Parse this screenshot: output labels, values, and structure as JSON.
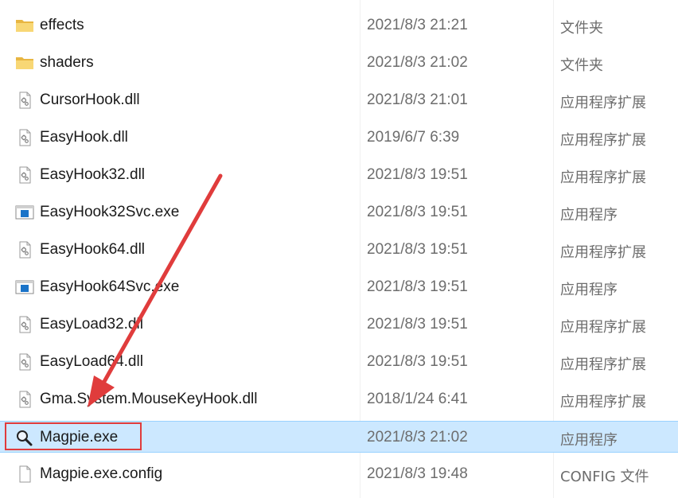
{
  "files": [
    {
      "name": "effects",
      "date": "2021/8/3 21:21",
      "type": "文件夹",
      "icon": "folder-icon",
      "selected": false
    },
    {
      "name": "shaders",
      "date": "2021/8/3 21:02",
      "type": "文件夹",
      "icon": "folder-icon",
      "selected": false
    },
    {
      "name": "CursorHook.dll",
      "date": "2021/8/3 21:01",
      "type": "应用程序扩展",
      "icon": "dll-file-icon",
      "selected": false
    },
    {
      "name": "EasyHook.dll",
      "date": "2019/6/7 6:39",
      "type": "应用程序扩展",
      "icon": "dll-file-icon",
      "selected": false
    },
    {
      "name": "EasyHook32.dll",
      "date": "2021/8/3 19:51",
      "type": "应用程序扩展",
      "icon": "dll-file-icon",
      "selected": false
    },
    {
      "name": "EasyHook32Svc.exe",
      "date": "2021/8/3 19:51",
      "type": "应用程序",
      "icon": "exe-window-icon",
      "selected": false
    },
    {
      "name": "EasyHook64.dll",
      "date": "2021/8/3 19:51",
      "type": "应用程序扩展",
      "icon": "dll-file-icon",
      "selected": false
    },
    {
      "name": "EasyHook64Svc.exe",
      "date": "2021/8/3 19:51",
      "type": "应用程序",
      "icon": "exe-window-icon",
      "selected": false
    },
    {
      "name": "EasyLoad32.dll",
      "date": "2021/8/3 19:51",
      "type": "应用程序扩展",
      "icon": "dll-file-icon",
      "selected": false
    },
    {
      "name": "EasyLoad64.dll",
      "date": "2021/8/3 19:51",
      "type": "应用程序扩展",
      "icon": "dll-file-icon",
      "selected": false
    },
    {
      "name": "Gma.System.MouseKeyHook.dll",
      "date": "2018/1/24 6:41",
      "type": "应用程序扩展",
      "icon": "dll-file-icon",
      "selected": false
    },
    {
      "name": "Magpie.exe",
      "date": "2021/8/3 21:02",
      "type": "应用程序",
      "icon": "magnifier-icon",
      "selected": true
    },
    {
      "name": "Magpie.exe.config",
      "date": "2021/8/3 19:48",
      "type": "CONFIG 文件",
      "icon": "blank-file-icon",
      "selected": false
    }
  ],
  "colors": {
    "selection_bg": "#cce8ff",
    "annotation_red": "#e03c3c",
    "folder_yellow": "#f8d775"
  }
}
